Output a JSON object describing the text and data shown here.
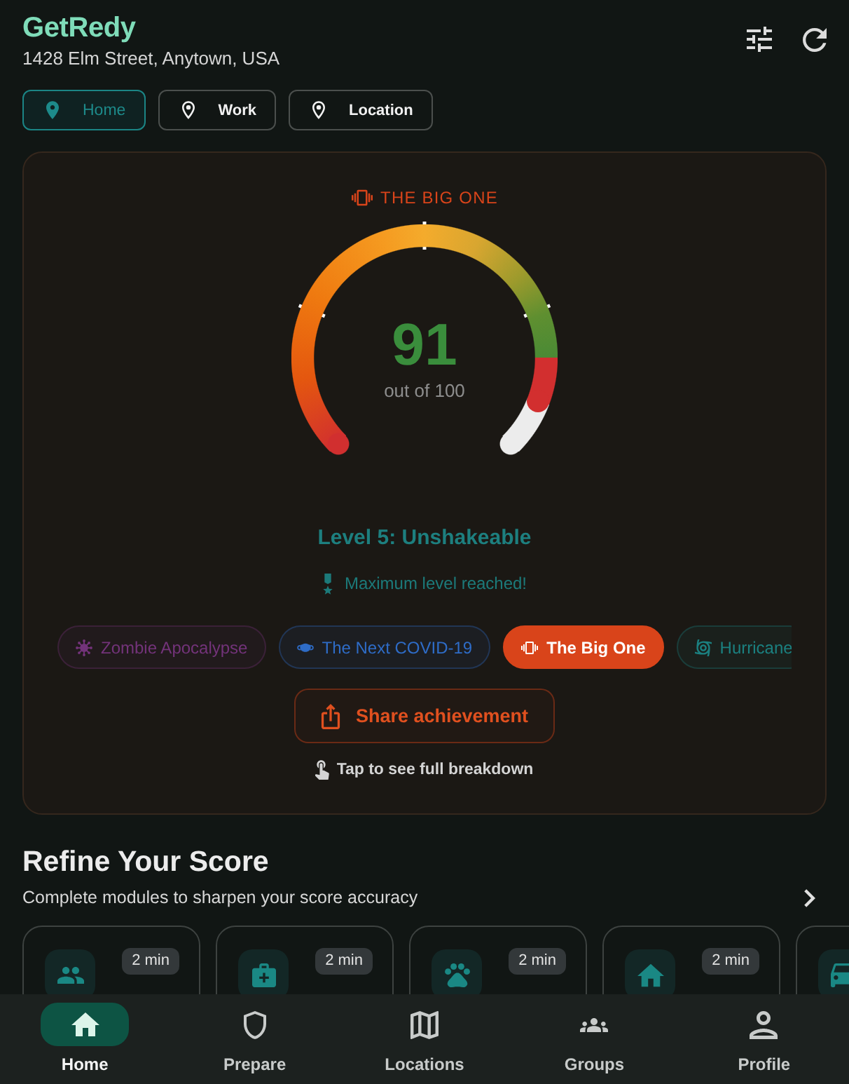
{
  "header": {
    "app_name": "GetRedy",
    "address": "1428 Elm Street, Anytown, USA"
  },
  "locations": [
    {
      "label": "Home",
      "selected": true
    },
    {
      "label": "Work",
      "selected": false
    },
    {
      "label": "Location",
      "selected": false
    }
  ],
  "score_card": {
    "hazard_title": "THE BIG ONE",
    "gauge": {
      "score": "91",
      "caption": "out of 100",
      "level": 0.91
    },
    "level_title": "Level 5: Unshakeable",
    "level_note": "Maximum level reached!",
    "hazards": [
      {
        "label": "Zombie Apocalypse",
        "kind": "zombie",
        "color": "#73337a",
        "selected": false
      },
      {
        "label": "The Next COVID-19",
        "kind": "pandemic",
        "color": "#2e6cc7",
        "selected": false
      },
      {
        "label": "The Big One",
        "kind": "earthquake",
        "color": "#d9441a",
        "selected": true
      },
      {
        "label": "Hurricane",
        "kind": "hurricane",
        "color": "#1b8080",
        "selected": false
      }
    ],
    "share_button": "Share achievement",
    "hint": "Tap to see full breakdown"
  },
  "refine": {
    "title": "Refine Your Score",
    "subtitle": "Complete modules to sharpen your score accuracy",
    "modules": [
      {
        "kind": "household",
        "duration": "2 min"
      },
      {
        "kind": "medical",
        "duration": "2 min"
      },
      {
        "kind": "pets",
        "duration": "2 min"
      },
      {
        "kind": "home",
        "duration": "2 min"
      },
      {
        "kind": "vehicle"
      }
    ]
  },
  "nav": [
    {
      "label": "Home",
      "kind": "home",
      "selected": true
    },
    {
      "label": "Prepare",
      "kind": "prepare",
      "selected": false
    },
    {
      "label": "Locations",
      "kind": "locations",
      "selected": false
    },
    {
      "label": "Groups",
      "kind": "groups",
      "selected": false
    },
    {
      "label": "Profile",
      "kind": "profile",
      "selected": false
    }
  ]
}
